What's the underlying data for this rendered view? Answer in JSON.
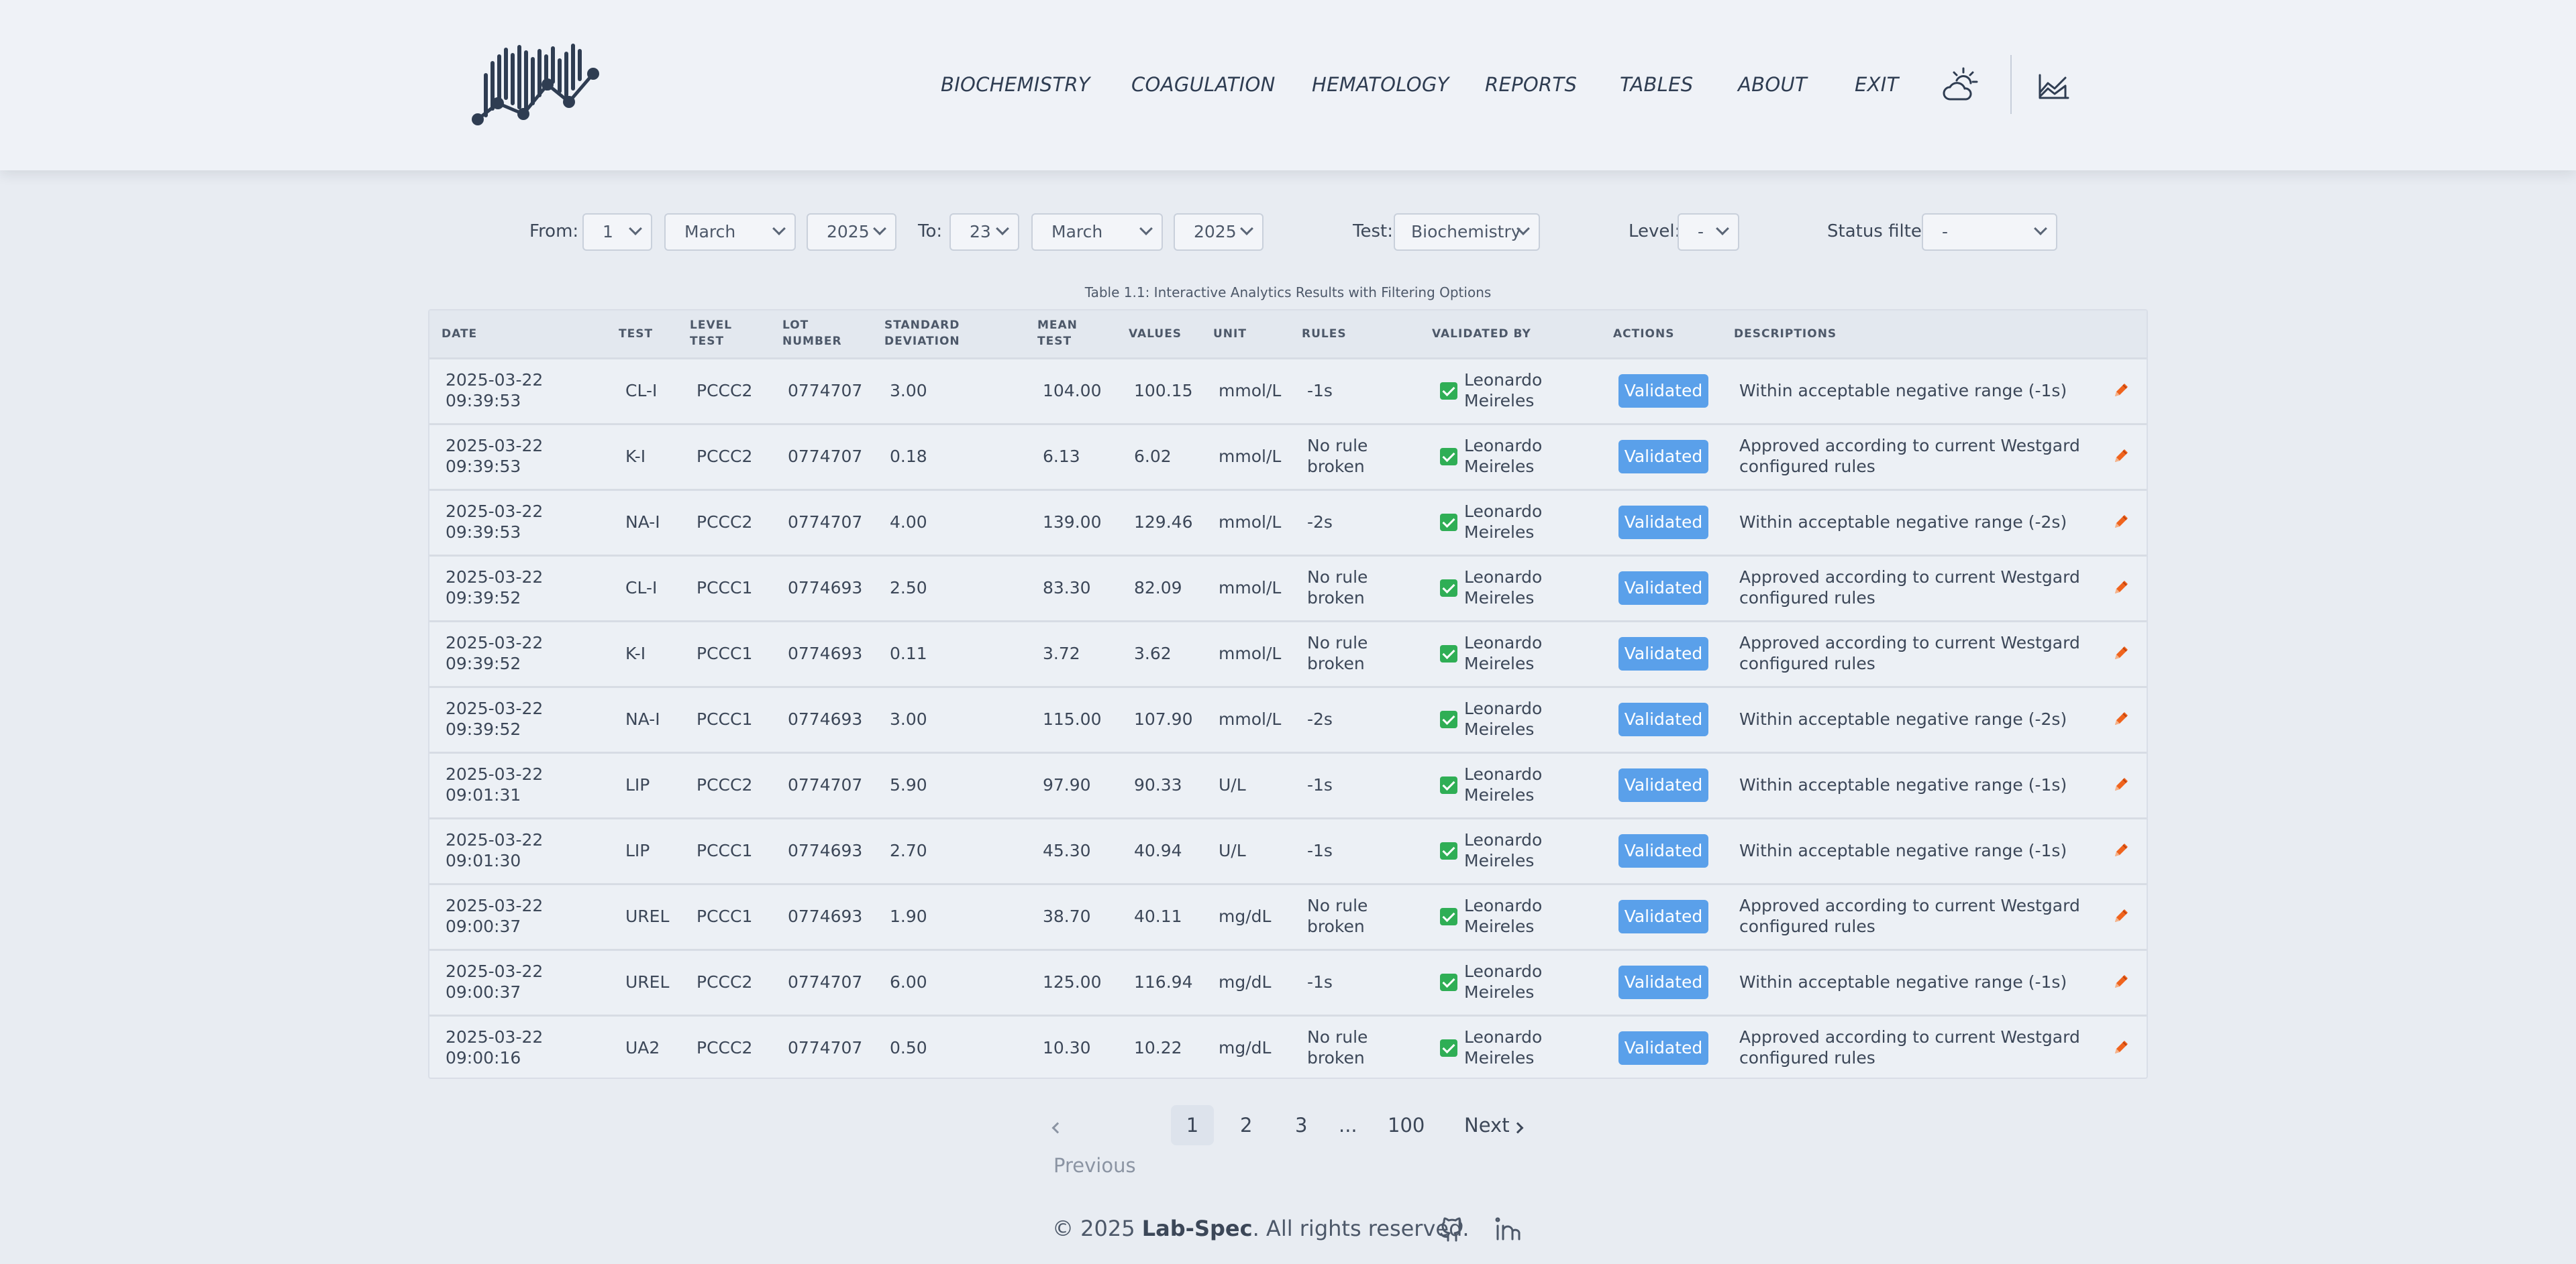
{
  "nav": {
    "items": [
      "BIOCHEMISTRY",
      "COAGULATION",
      "HEMATOLOGY",
      "REPORTS",
      "TABLES",
      "ABOUT",
      "EXIT"
    ],
    "theme_icon": "weather-partly-sunny-icon",
    "chart_icon": "area-chart-icon"
  },
  "filters": {
    "from_label": "From:",
    "from_day": "1",
    "from_month": "March",
    "from_year": "2025",
    "to_label": "To:",
    "to_day": "23",
    "to_month": "March",
    "to_year": "2025",
    "test_label": "Test:",
    "test_value": "Biochemistry",
    "level_label": "Level:",
    "level_value": "-",
    "status_label": "Status filter:",
    "status_value": "-"
  },
  "caption": "Table 1.1: Interactive Analytics Results with Filtering Options",
  "table": {
    "headers": {
      "date": "DATE",
      "test": "TEST",
      "level1": "LEVEL",
      "level2": "TEST",
      "lot1": "LOT",
      "lot2": "NUMBER",
      "sd1": "STANDARD",
      "sd2": "DEVIATION",
      "mean1": "MEAN",
      "mean2": "TEST",
      "values": "VALUES",
      "unit": "UNIT",
      "rules": "RULES",
      "validated_by": "VALIDATED BY",
      "actions": "ACTIONS",
      "descriptions": "DESCRIPTIONS"
    },
    "rows": [
      {
        "date": "2025-03-22",
        "time": "09:39:53",
        "test": "CL-I",
        "level": "PCCC2",
        "lot": "0774707",
        "sd": "3.00",
        "mean": "104.00",
        "value": "100.15",
        "unit": "mmol/L",
        "rule1": "-1s",
        "rule2": "",
        "user1": "Leonardo",
        "user2": "Meireles",
        "status": "Validated",
        "desc1": "Within acceptable negative range (-1s)",
        "desc2": ""
      },
      {
        "date": "2025-03-22",
        "time": "09:39:53",
        "test": "K-I",
        "level": "PCCC2",
        "lot": "0774707",
        "sd": "0.18",
        "mean": "6.13",
        "value": "6.02",
        "unit": "mmol/L",
        "rule1": "No rule",
        "rule2": "broken",
        "user1": "Leonardo",
        "user2": "Meireles",
        "status": "Validated",
        "desc1": "Approved according to current Westgard",
        "desc2": "configured rules"
      },
      {
        "date": "2025-03-22",
        "time": "09:39:53",
        "test": "NA-I",
        "level": "PCCC2",
        "lot": "0774707",
        "sd": "4.00",
        "mean": "139.00",
        "value": "129.46",
        "unit": "mmol/L",
        "rule1": "-2s",
        "rule2": "",
        "user1": "Leonardo",
        "user2": "Meireles",
        "status": "Validated",
        "desc1": "Within acceptable negative range (-2s)",
        "desc2": ""
      },
      {
        "date": "2025-03-22",
        "time": "09:39:52",
        "test": "CL-I",
        "level": "PCCC1",
        "lot": "0774693",
        "sd": "2.50",
        "mean": "83.30",
        "value": "82.09",
        "unit": "mmol/L",
        "rule1": "No rule",
        "rule2": "broken",
        "user1": "Leonardo",
        "user2": "Meireles",
        "status": "Validated",
        "desc1": "Approved according to current Westgard",
        "desc2": "configured rules"
      },
      {
        "date": "2025-03-22",
        "time": "09:39:52",
        "test": "K-I",
        "level": "PCCC1",
        "lot": "0774693",
        "sd": "0.11",
        "mean": "3.72",
        "value": "3.62",
        "unit": "mmol/L",
        "rule1": "No rule",
        "rule2": "broken",
        "user1": "Leonardo",
        "user2": "Meireles",
        "status": "Validated",
        "desc1": "Approved according to current Westgard",
        "desc2": "configured rules"
      },
      {
        "date": "2025-03-22",
        "time": "09:39:52",
        "test": "NA-I",
        "level": "PCCC1",
        "lot": "0774693",
        "sd": "3.00",
        "mean": "115.00",
        "value": "107.90",
        "unit": "mmol/L",
        "rule1": "-2s",
        "rule2": "",
        "user1": "Leonardo",
        "user2": "Meireles",
        "status": "Validated",
        "desc1": "Within acceptable negative range (-2s)",
        "desc2": ""
      },
      {
        "date": "2025-03-22",
        "time": "09:01:31",
        "test": "LIP",
        "level": "PCCC2",
        "lot": "0774707",
        "sd": "5.90",
        "mean": "97.90",
        "value": "90.33",
        "unit": "U/L",
        "rule1": "-1s",
        "rule2": "",
        "user1": "Leonardo",
        "user2": "Meireles",
        "status": "Validated",
        "desc1": "Within acceptable negative range (-1s)",
        "desc2": ""
      },
      {
        "date": "2025-03-22",
        "time": "09:01:30",
        "test": "LIP",
        "level": "PCCC1",
        "lot": "0774693",
        "sd": "2.70",
        "mean": "45.30",
        "value": "40.94",
        "unit": "U/L",
        "rule1": "-1s",
        "rule2": "",
        "user1": "Leonardo",
        "user2": "Meireles",
        "status": "Validated",
        "desc1": "Within acceptable negative range (-1s)",
        "desc2": ""
      },
      {
        "date": "2025-03-22",
        "time": "09:00:37",
        "test": "UREL",
        "level": "PCCC1",
        "lot": "0774693",
        "sd": "1.90",
        "mean": "38.70",
        "value": "40.11",
        "unit": "mg/dL",
        "rule1": "No rule",
        "rule2": "broken",
        "user1": "Leonardo",
        "user2": "Meireles",
        "status": "Validated",
        "desc1": "Approved according to current Westgard",
        "desc2": "configured rules"
      },
      {
        "date": "2025-03-22",
        "time": "09:00:37",
        "test": "UREL",
        "level": "PCCC2",
        "lot": "0774707",
        "sd": "6.00",
        "mean": "125.00",
        "value": "116.94",
        "unit": "mg/dL",
        "rule1": "-1s",
        "rule2": "",
        "user1": "Leonardo",
        "user2": "Meireles",
        "status": "Validated",
        "desc1": "Within acceptable negative range (-1s)",
        "desc2": ""
      },
      {
        "date": "2025-03-22",
        "time": "09:00:16",
        "test": "UA2",
        "level": "PCCC2",
        "lot": "0774707",
        "sd": "0.50",
        "mean": "10.30",
        "value": "10.22",
        "unit": "mg/dL",
        "rule1": "No rule",
        "rule2": "broken",
        "user1": "Leonardo",
        "user2": "Meireles",
        "status": "Validated",
        "desc1": "Approved according to current Westgard",
        "desc2": "configured rules"
      }
    ]
  },
  "pagination": {
    "previous": "Previous",
    "pages": [
      "1",
      "2",
      "3",
      "...",
      "100"
    ],
    "next": "Next"
  },
  "footer": {
    "copyright": "© 2025",
    "brand": "Lab-Spec",
    "rights": ". All rights reserved.",
    "github_icon": "github-icon",
    "linkedin_icon": "linkedin-icon"
  },
  "colors": {
    "background": "#e8ecf2",
    "header": "#eff2f7",
    "badge": "#5aa0ea",
    "check": "#2fae55",
    "edit": "#f0641e"
  }
}
